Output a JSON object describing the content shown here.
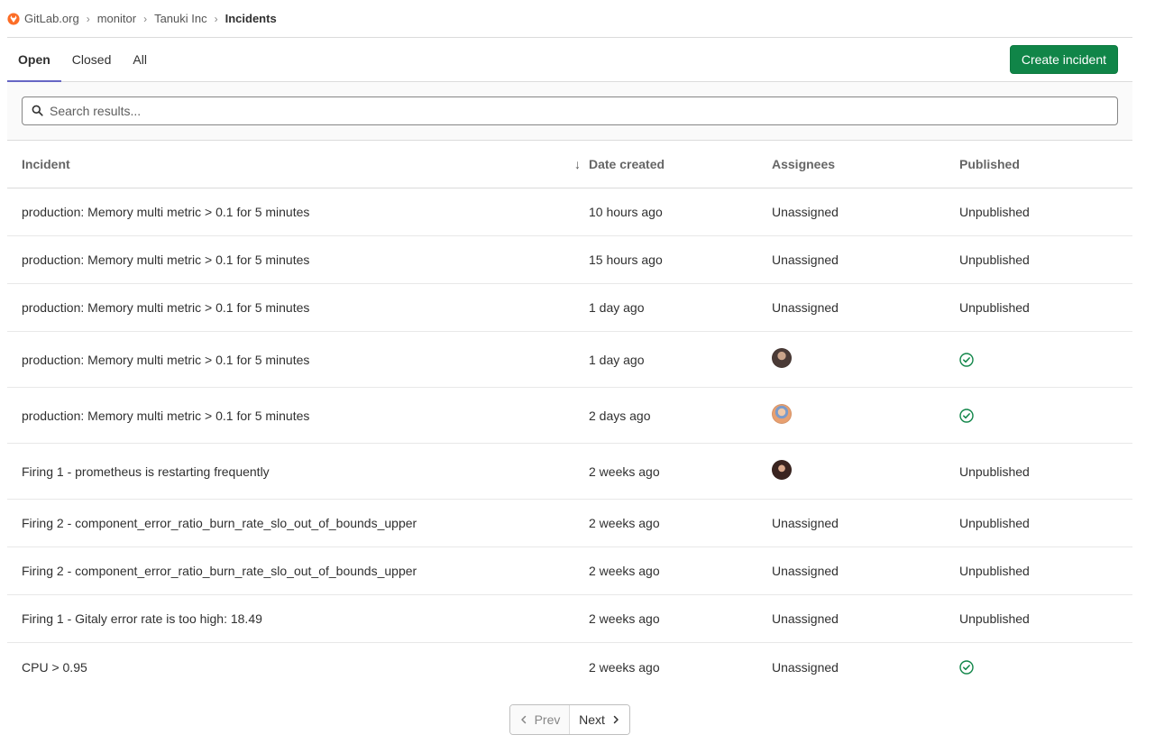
{
  "breadcrumb": {
    "items": [
      "GitLab.org",
      "monitor",
      "Tanuki Inc"
    ],
    "current": "Incidents"
  },
  "tabs": [
    {
      "label": "Open",
      "active": true
    },
    {
      "label": "Closed",
      "active": false
    },
    {
      "label": "All",
      "active": false
    }
  ],
  "create_button_label": "Create incident",
  "search": {
    "placeholder": "Search results..."
  },
  "table": {
    "headers": {
      "incident": "Incident",
      "date_created": "Date created",
      "assignees": "Assignees",
      "published": "Published"
    },
    "sort_icon": "arrow-down-icon",
    "rows": [
      {
        "title": "production: Memory multi metric > 0.1 for 5 minutes",
        "date": "10 hours ago",
        "assignee": "Unassigned",
        "published": "Unpublished"
      },
      {
        "title": "production: Memory multi metric > 0.1 for 5 minutes",
        "date": "15 hours ago",
        "assignee": "Unassigned",
        "published": "Unpublished"
      },
      {
        "title": "production: Memory multi metric > 0.1 for 5 minutes",
        "date": "1 day ago",
        "assignee": "Unassigned",
        "published": "Unpublished"
      },
      {
        "title": "production: Memory multi metric > 0.1 for 5 minutes",
        "date": "1 day ago",
        "assignee": "avatar",
        "published": "check-circle-icon"
      },
      {
        "title": "production: Memory multi metric > 0.1 for 5 minutes",
        "date": "2 days ago",
        "assignee": "avatar",
        "published": "check-circle-icon"
      },
      {
        "title": "Firing 1 - prometheus is restarting frequently",
        "date": "2 weeks ago",
        "assignee": "avatar",
        "published": "Unpublished"
      },
      {
        "title": "Firing 2 - component_error_ratio_burn_rate_slo_out_of_bounds_upper",
        "date": "2 weeks ago",
        "assignee": "Unassigned",
        "published": "Unpublished"
      },
      {
        "title": "Firing 2 - component_error_ratio_burn_rate_slo_out_of_bounds_upper",
        "date": "2 weeks ago",
        "assignee": "Unassigned",
        "published": "Unpublished"
      },
      {
        "title": "Firing 1 - Gitaly error rate is too high: 18.49",
        "date": "2 weeks ago",
        "assignee": "Unassigned",
        "published": "Unpublished"
      },
      {
        "title": "CPU > 0.95",
        "date": "2 weeks ago",
        "assignee": "Unassigned",
        "published": "check-circle-icon"
      }
    ]
  },
  "pagination": {
    "prev": "Prev",
    "next": "Next"
  },
  "colors": {
    "primary_green": "#108548",
    "tab_underline": "#6666c4",
    "check_green": "#108548"
  }
}
